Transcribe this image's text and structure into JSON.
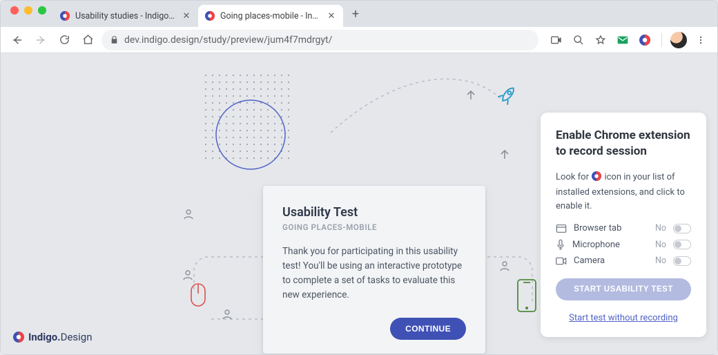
{
  "tabs": [
    {
      "title": "Usability studies - Indigo.Design"
    },
    {
      "title": "Going places-mobile - Indigo.D"
    }
  ],
  "url": "dev.indigo.design/study/preview/jum4f7mdrgyt/",
  "center": {
    "heading": "Usability Test",
    "subtitle": "GOING PLACES-MOBILE",
    "body": "Thank you for participating in this usability test! You'll be using an interactive prototype to complete a set of tasks to evaluate this new experience.",
    "cta": "CONTINUE"
  },
  "panel": {
    "heading": "Enable Chrome extension to record session",
    "para_before": "Look for",
    "para_after": "icon in your list of installed extensions, and click to enable it.",
    "perms": [
      {
        "icon": "tab",
        "label": "Browser tab",
        "state": "No"
      },
      {
        "icon": "mic",
        "label": "Microphone",
        "state": "No"
      },
      {
        "icon": "cam",
        "label": "Camera",
        "state": "No"
      }
    ],
    "start_btn": "START USABILITY TEST",
    "alt_link": "Start test without recording"
  },
  "brand": {
    "name_a": "Indigo.",
    "name_b": "Design"
  }
}
